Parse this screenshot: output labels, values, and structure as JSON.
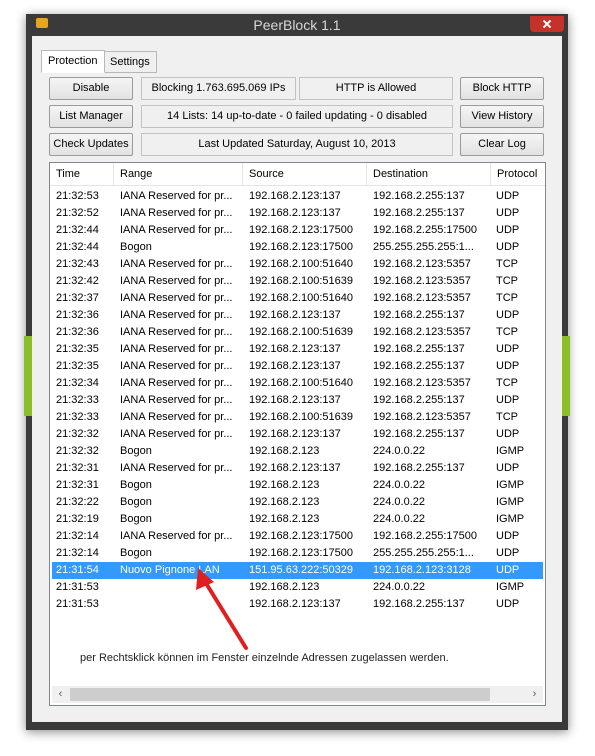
{
  "window": {
    "title": "PeerBlock 1.1"
  },
  "tabs": [
    "Protection",
    "Settings"
  ],
  "buttons": {
    "disable": "Disable",
    "list_manager": "List Manager",
    "check_updates": "Check Updates",
    "block_http": "Block HTTP",
    "view_history": "View History",
    "clear_log": "Clear Log"
  },
  "status": {
    "blocking": "Blocking 1.763.695.069 IPs",
    "http": "HTTP is Allowed",
    "lists": "14 Lists: 14 up-to-date - 0 failed updating - 0 disabled",
    "last_updated": "Last Updated Saturday, August 10, 2013"
  },
  "log": {
    "columns": [
      "Time",
      "Range",
      "Source",
      "Destination",
      "Protocol"
    ],
    "rows": [
      [
        "21:32:53",
        "IANA Reserved for pr...",
        "192.168.2.123:137",
        "192.168.2.255:137",
        "UDP"
      ],
      [
        "21:32:52",
        "IANA Reserved for pr...",
        "192.168.2.123:137",
        "192.168.2.255:137",
        "UDP"
      ],
      [
        "21:32:44",
        "IANA Reserved for pr...",
        "192.168.2.123:17500",
        "192.168.2.255:17500",
        "UDP"
      ],
      [
        "21:32:44",
        "Bogon",
        "192.168.2.123:17500",
        "255.255.255.255:1...",
        "UDP"
      ],
      [
        "21:32:43",
        "IANA Reserved for pr...",
        "192.168.2.100:51640",
        "192.168.2.123:5357",
        "TCP"
      ],
      [
        "21:32:42",
        "IANA Reserved for pr...",
        "192.168.2.100:51639",
        "192.168.2.123:5357",
        "TCP"
      ],
      [
        "21:32:37",
        "IANA Reserved for pr...",
        "192.168.2.100:51640",
        "192.168.2.123:5357",
        "TCP"
      ],
      [
        "21:32:36",
        "IANA Reserved for pr...",
        "192.168.2.123:137",
        "192.168.2.255:137",
        "UDP"
      ],
      [
        "21:32:36",
        "IANA Reserved for pr...",
        "192.168.2.100:51639",
        "192.168.2.123:5357",
        "TCP"
      ],
      [
        "21:32:35",
        "IANA Reserved for pr...",
        "192.168.2.123:137",
        "192.168.2.255:137",
        "UDP"
      ],
      [
        "21:32:35",
        "IANA Reserved for pr...",
        "192.168.2.123:137",
        "192.168.2.255:137",
        "UDP"
      ],
      [
        "21:32:34",
        "IANA Reserved for pr...",
        "192.168.2.100:51640",
        "192.168.2.123:5357",
        "TCP"
      ],
      [
        "21:32:33",
        "IANA Reserved for pr...",
        "192.168.2.123:137",
        "192.168.2.255:137",
        "UDP"
      ],
      [
        "21:32:33",
        "IANA Reserved for pr...",
        "192.168.2.100:51639",
        "192.168.2.123:5357",
        "TCP"
      ],
      [
        "21:32:32",
        "IANA Reserved for pr...",
        "192.168.2.123:137",
        "192.168.2.255:137",
        "UDP"
      ],
      [
        "21:32:32",
        "Bogon",
        "192.168.2.123",
        "224.0.0.22",
        "IGMP"
      ],
      [
        "21:32:31",
        "IANA Reserved for pr...",
        "192.168.2.123:137",
        "192.168.2.255:137",
        "UDP"
      ],
      [
        "21:32:31",
        "Bogon",
        "192.168.2.123",
        "224.0.0.22",
        "IGMP"
      ],
      [
        "21:32:22",
        "Bogon",
        "192.168.2.123",
        "224.0.0.22",
        "IGMP"
      ],
      [
        "21:32:19",
        "Bogon",
        "192.168.2.123",
        "224.0.0.22",
        "IGMP"
      ],
      [
        "21:32:14",
        "IANA Reserved for pr...",
        "192.168.2.123:17500",
        "192.168.2.255:17500",
        "UDP"
      ],
      [
        "21:32:14",
        "Bogon",
        "192.168.2.123:17500",
        "255.255.255.255:1...",
        "UDP"
      ],
      [
        "21:31:54",
        "Nuovo Pignone LAN",
        "151.95.63.222:50329",
        "192.168.2.123:3128",
        "UDP"
      ],
      [
        "21:31:53",
        "",
        "192.168.2.123",
        "224.0.0.22",
        "IGMP"
      ],
      [
        "21:31:53",
        "",
        "192.168.2.123:137",
        "192.168.2.255:137",
        "UDP"
      ]
    ],
    "selected_row": 22
  },
  "annotation": {
    "text": "per Rechtsklick können im Fenster einzelnde Adressen zugelassen werden.",
    "arrow_color": "#e02020"
  },
  "colors": {
    "selection": "#3399ff",
    "accent_green": "#8bbf2a",
    "close": "#c5322a"
  }
}
